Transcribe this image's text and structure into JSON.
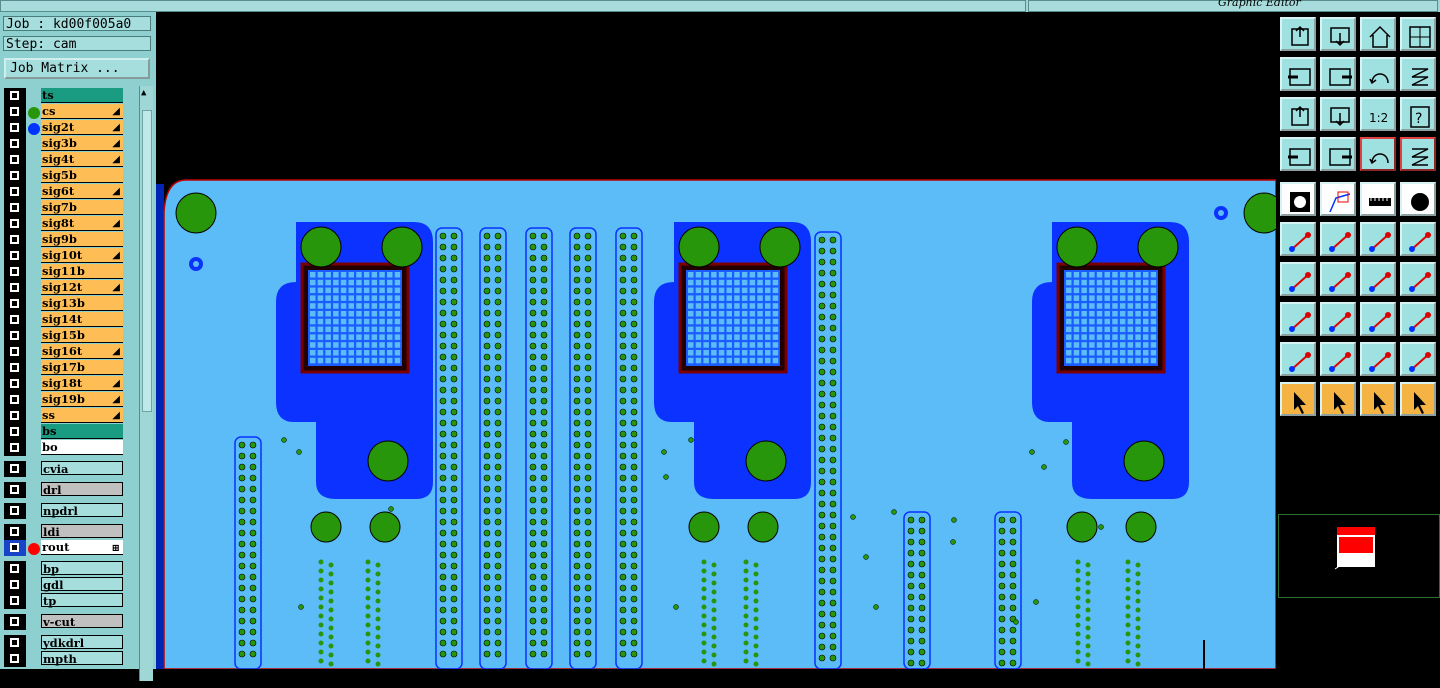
{
  "window": {
    "title": "Graphic Editor"
  },
  "info": {
    "job": "Job : kd00f005a0",
    "step": "Step: cam",
    "job_matrix_button": "Job Matrix ..."
  },
  "colors": {
    "panel": "#8ecfcf",
    "board": "#5bbcf8",
    "copper": "#0b32ff",
    "pad": "#28960a",
    "row_orange": "#ffbe55",
    "row_teal": "#1a9c83",
    "row_gray": "#c0c0c0",
    "toolbar_orange": "#f4b342"
  },
  "layers": [
    {
      "name": "ts",
      "style": "teal"
    },
    {
      "name": "cs",
      "style": "orange",
      "dot": "#28960a",
      "mark": true
    },
    {
      "name": "sig2t",
      "style": "orange",
      "dot": "#0033ff",
      "mark": true
    },
    {
      "name": "sig3b",
      "style": "orange",
      "mark": true
    },
    {
      "name": "sig4t",
      "style": "orange",
      "mark": true
    },
    {
      "name": "sig5b",
      "style": "orange"
    },
    {
      "name": "sig6t",
      "style": "orange",
      "mark": true
    },
    {
      "name": "sig7b",
      "style": "orange"
    },
    {
      "name": "sig8t",
      "style": "orange",
      "mark": true
    },
    {
      "name": "sig9b",
      "style": "orange"
    },
    {
      "name": "sig10t",
      "style": "orange",
      "mark": true
    },
    {
      "name": "sig11b",
      "style": "orange"
    },
    {
      "name": "sig12t",
      "style": "orange",
      "mark": true
    },
    {
      "name": "sig13b",
      "style": "orange"
    },
    {
      "name": "sig14t",
      "style": "orange"
    },
    {
      "name": "sig15b",
      "style": "orange"
    },
    {
      "name": "sig16t",
      "style": "orange",
      "mark": true
    },
    {
      "name": "sig17b",
      "style": "orange"
    },
    {
      "name": "sig18t",
      "style": "orange",
      "mark": true
    },
    {
      "name": "sig19b",
      "style": "orange",
      "mark": true
    },
    {
      "name": "ss",
      "style": "orange",
      "mark": true
    },
    {
      "name": "bs",
      "style": "teal"
    },
    {
      "name": "bo",
      "style": "white"
    },
    {
      "name": "cvia",
      "style": "panel",
      "gap": true
    },
    {
      "name": "drl",
      "style": "gray",
      "gap": true
    },
    {
      "name": "npdrl",
      "style": "panel",
      "gap": true
    },
    {
      "name": "ldi",
      "style": "gray",
      "gap": true
    },
    {
      "name": "rout",
      "style": "white",
      "dot": "#ff0000",
      "active": true,
      "hash": true
    },
    {
      "name": "bp",
      "style": "panel",
      "gap": true
    },
    {
      "name": "gdl",
      "style": "panel"
    },
    {
      "name": "tp",
      "style": "panel"
    },
    {
      "name": "v-cut",
      "style": "gray",
      "gap": true
    },
    {
      "name": "ydkdrl",
      "style": "panel",
      "gap": true
    },
    {
      "name": "mpth",
      "style": "panel"
    }
  ],
  "toolbar_icons": [
    "zoom-home-icon",
    "zoom-in-icon",
    "house-icon",
    "grid-xy-icon",
    "pan-left-icon",
    "pan-right-icon",
    "zoom-back-icon",
    "redraw-icon",
    "fit-screen-icon",
    "zoom-fit-icon",
    "scale-1-2-icon",
    "help-icon",
    "snap-settings-icon",
    "probe-icon",
    "net-compare-icon",
    "net-analyze-icon",
    "select-pad-icon",
    "select-feature-icon",
    "measure-ruler-icon",
    "feature-filter-icon",
    "connect-nodes-icon",
    "delete-node-icon",
    "add-segment-icon",
    "add-arc-icon",
    "angle-line-icon",
    "cut-line-icon",
    "rotate-icon",
    "mirror-icon",
    "move-pad-icon",
    "line-icon",
    "dimension-icon",
    "shapes-icon",
    "triangle-icon",
    "triangle-up-icon",
    "triangle-outline-icon",
    "triangle-cut-icon",
    "select-arrow-icon",
    "select-box-icon",
    "select-poly-icon",
    "select-net-icon"
  ],
  "scale_label": "1:2"
}
